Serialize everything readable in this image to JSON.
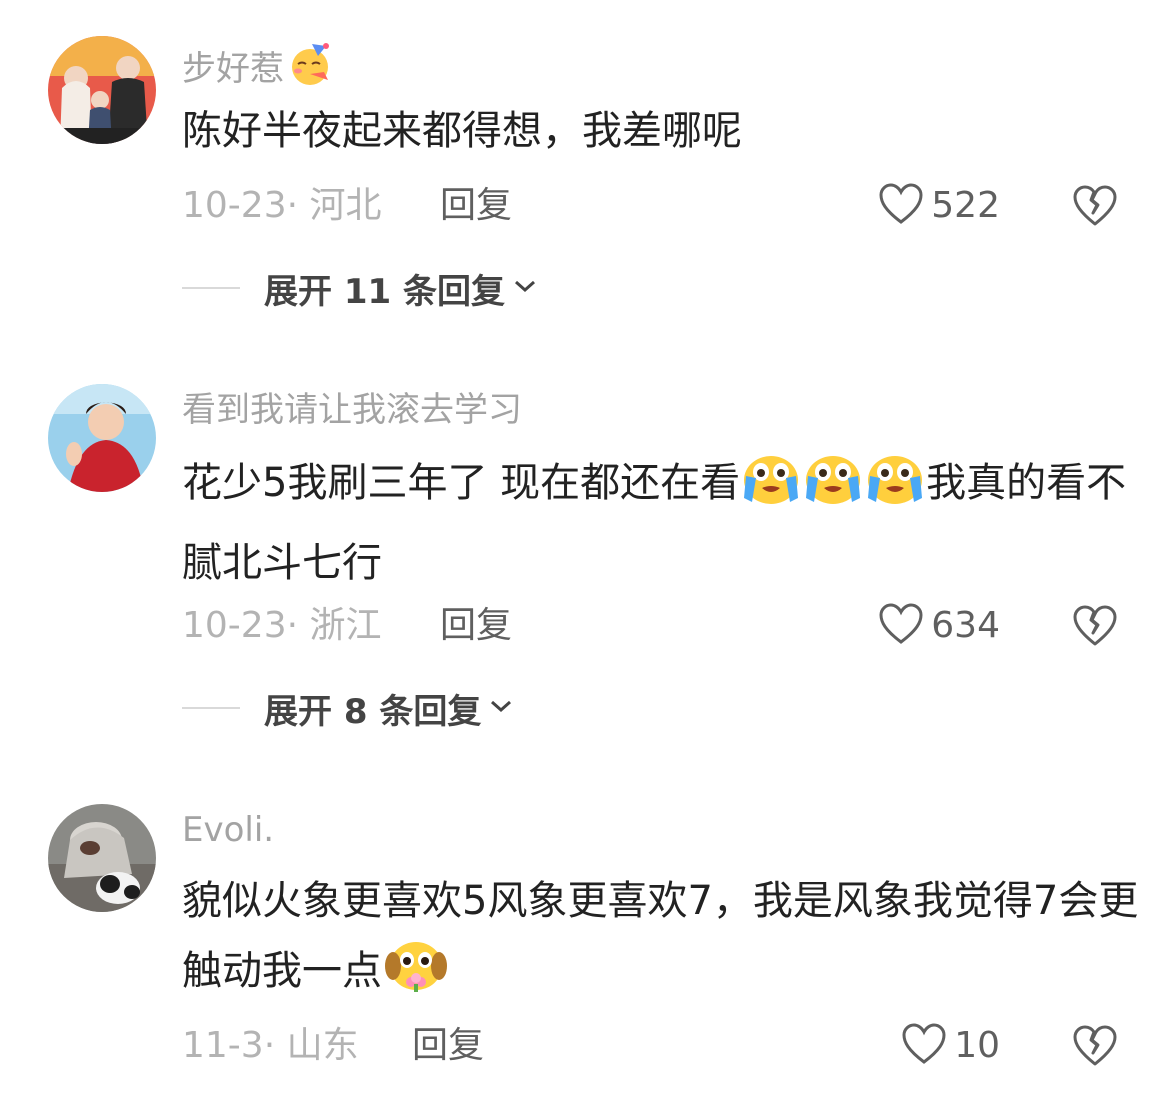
{
  "comments": [
    {
      "avatar": "family-photo-avatar",
      "username": "步好惹",
      "username_emoji": "party-face-emoji",
      "text_parts": [
        "陈好半夜起来都得想，我差哪呢"
      ],
      "date_location": "10-23· 河北",
      "reply_label": "回复",
      "likes": "522",
      "expand_label": "展开 11 条回复"
    },
    {
      "avatar": "woman-red-coat-avatar",
      "username": "看到我请让我滚去学习",
      "text_parts": [
        "花少5我刷三年了 现在都还在看",
        "我真的看不腻北斗七行"
      ],
      "text_emoji": "crying-face-emoji",
      "date_location": "10-23· 浙江",
      "reply_label": "回复",
      "likes": "634",
      "expand_label": "展开 8 条回复"
    },
    {
      "avatar": "person-with-dog-avatar",
      "username": "Evoli.",
      "text_parts": [
        "貌似火象更喜欢5风象更喜欢7，我是风象我觉得7会更触动我一点"
      ],
      "text_emoji": "puppy-flower-emoji",
      "date_location": "11-3· 山东",
      "reply_label": "回复",
      "likes": "10"
    }
  ],
  "icons": {
    "like": "heart-outline-icon",
    "dislike": "broken-heart-icon",
    "expand": "chevron-down-icon"
  },
  "colors": {
    "username": "#a3a3a3",
    "meta": "#b3b3b3",
    "body_text": "#222222",
    "action": "#5f5f5f"
  }
}
